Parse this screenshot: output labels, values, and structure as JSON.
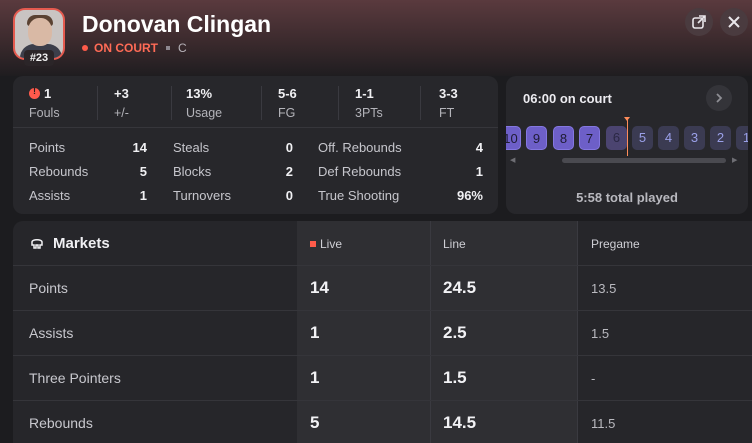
{
  "player": {
    "name": "Donovan Clingan",
    "jersey": "#23",
    "status": "ON COURT",
    "position": "C"
  },
  "header_buttons": {
    "open_icon": "external-link-icon",
    "close_icon": "close-icon"
  },
  "top_stats": [
    {
      "value": "1",
      "label": "Fouls",
      "has_alert": true
    },
    {
      "value": "+3",
      "label": "+/-"
    },
    {
      "value": "13%",
      "label": "Usage"
    },
    {
      "value": "5-6",
      "label": "FG"
    },
    {
      "value": "1-1",
      "label": "3PTs"
    },
    {
      "value": "3-3",
      "label": "FT"
    }
  ],
  "stat_rows": [
    [
      {
        "label": "Points",
        "value": "14"
      },
      {
        "label": "Steals",
        "value": "0"
      },
      {
        "label": "Off. Rebounds",
        "value": "4"
      }
    ],
    [
      {
        "label": "Rebounds",
        "value": "5"
      },
      {
        "label": "Blocks",
        "value": "2"
      },
      {
        "label": "Def Rebounds",
        "value": "1"
      }
    ],
    [
      {
        "label": "Assists",
        "value": "1"
      },
      {
        "label": "Turnovers",
        "value": "0"
      },
      {
        "label": "True Shooting",
        "value": "96%"
      }
    ]
  ],
  "court_time": {
    "title": "06:00 on court",
    "total": "5:58 total played",
    "minutes": [
      "10",
      "9",
      "8",
      "7",
      "6",
      "5",
      "4",
      "3",
      "2",
      "1"
    ]
  },
  "markets": {
    "title": "Markets",
    "headers": {
      "live": "Live",
      "line": "Line",
      "pregame": "Pregame"
    },
    "rows": [
      {
        "label": "Points",
        "live": "14",
        "line": "24.5",
        "pregame": "13.5"
      },
      {
        "label": "Assists",
        "live": "1",
        "line": "2.5",
        "pregame": "1.5"
      },
      {
        "label": "Three Pointers",
        "live": "1",
        "line": "1.5",
        "pregame": "-"
      },
      {
        "label": "Rebounds",
        "live": "5",
        "line": "14.5",
        "pregame": "11.5"
      }
    ]
  },
  "colors": {
    "accent_red": "#ff5b4a",
    "timeline_purple": "#6d5fc8",
    "card_bg": "#27272b"
  }
}
